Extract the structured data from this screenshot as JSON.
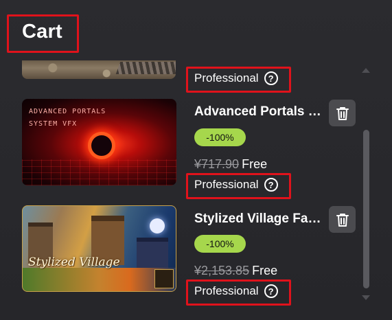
{
  "cart": {
    "title": "Cart",
    "items": [
      {
        "license": "Professional"
      },
      {
        "name": "Advanced Portals System VFX",
        "thumbnail_text": "ADVANCED PORTALS\nSYSTEM VFX",
        "discount": "-100%",
        "original_price": "¥717.90",
        "price": "Free",
        "license": "Professional"
      },
      {
        "name": "Stylized Village Fantasy",
        "thumbnail_logo": "Stylized Village",
        "discount": "-100%",
        "original_price": "¥2,153.85",
        "price": "Free",
        "license": "Professional"
      }
    ]
  },
  "icons": {
    "help": "question-circle-icon",
    "delete": "trash-icon"
  },
  "colors": {
    "background": "#2b2b2f",
    "discount_badge": "#a6d74c",
    "highlight": "#e0121b",
    "button": "#4b4b4f"
  }
}
